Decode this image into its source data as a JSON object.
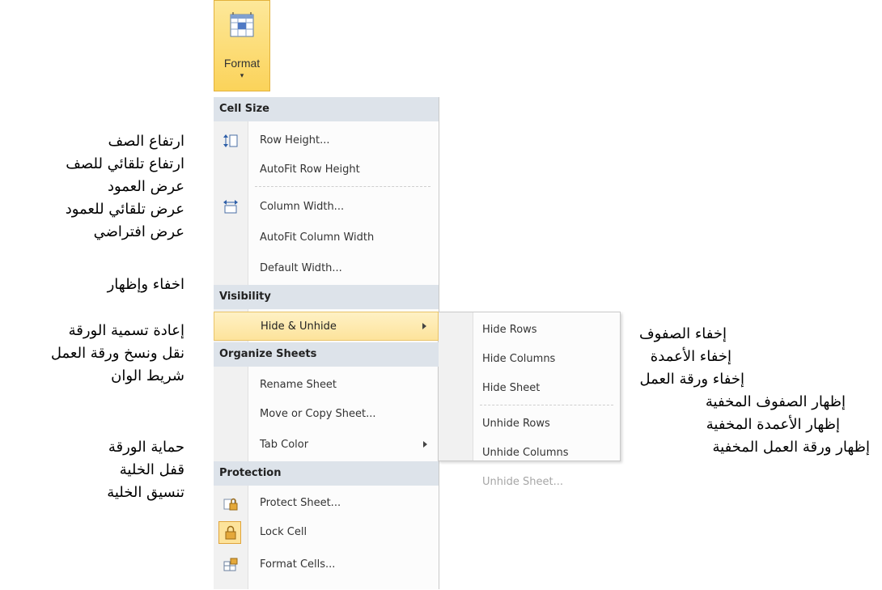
{
  "ribbon": {
    "format_label": "Format",
    "format_arrow": "▾",
    "format_icon": "format-cells-icon"
  },
  "menu": {
    "sections": {
      "cell_size": "Cell Size",
      "visibility": "Visibility",
      "organize_sheets": "Organize Sheets",
      "protection": "Protection"
    },
    "items": {
      "row_height": "Row Height...",
      "autofit_row_height": "AutoFit Row Height",
      "column_width": "Column Width...",
      "autofit_column_width": "AutoFit Column Width",
      "default_width": "Default Width...",
      "hide_unhide": "Hide & Unhide",
      "rename_sheet": "Rename Sheet",
      "move_copy_sheet": "Move or Copy Sheet...",
      "tab_color": "Tab Color",
      "protect_sheet": "Protect Sheet...",
      "lock_cell": "Lock Cell",
      "format_cells": "Format Cells..."
    }
  },
  "submenu": {
    "hide_rows": "Hide Rows",
    "hide_columns": "Hide Columns",
    "hide_sheet": "Hide Sheet",
    "unhide_rows": "Unhide Rows",
    "unhide_columns": "Unhide Columns",
    "unhide_sheet": "Unhide Sheet..."
  },
  "annotations_left": {
    "row_height": "ارتفاع الصف",
    "autofit_row": "ارتفاع تلقائي للصف",
    "column_width": "عرض العمود",
    "autofit_column": "عرض تلقائي للعمود",
    "default_width": "عرض افتراضي",
    "hide_unhide": "اخفاء وإظهار",
    "rename_sheet": "إعادة تسمية الورقة",
    "move_copy": "نقل ونسخ ورقة العمل",
    "tab_color": "شريط الوان",
    "protect_sheet": "حماية الورقة",
    "lock_cell": "قفل الخلية",
    "format_cells": "تنسيق الخلية"
  },
  "annotations_right": {
    "hide_rows": "إخفاء الصفوف",
    "hide_columns": "إخفاء الأعمدة",
    "hide_sheet": "إخفاء ورقة العمل",
    "unhide_rows": "إظهار الصفوف المخفية",
    "unhide_columns": "إظهار الأعمدة المخفية",
    "unhide_sheet": "إظهار ورقة العمل المخفية"
  },
  "colors": {
    "highlight": "#fde39b",
    "section_bg": "#dde3ea",
    "disabled_text": "#a6a6a6"
  }
}
